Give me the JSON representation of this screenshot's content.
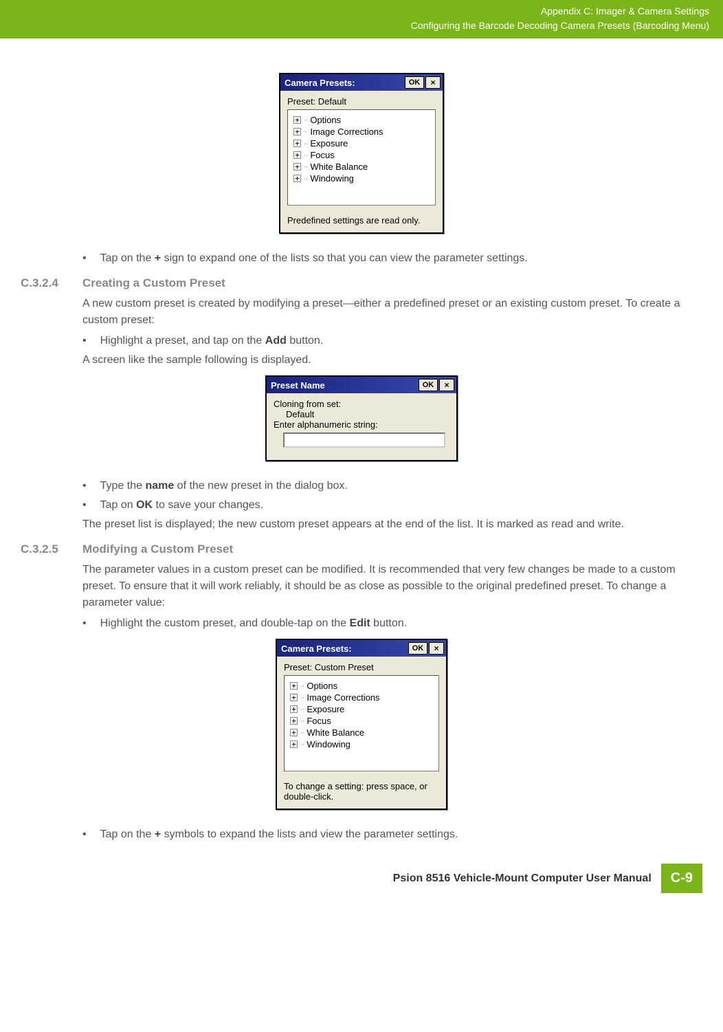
{
  "header": {
    "line1": "Appendix C: Imager & Camera Settings",
    "line2": "Configuring the Barcode Decoding Camera Presets (Barcoding Menu)"
  },
  "dialog1": {
    "title": "Camera Presets:",
    "ok": "OK",
    "close": "×",
    "preset_label": "Preset:  Default",
    "items": [
      "Options",
      "Image Corrections",
      "Exposure",
      "Focus",
      "White Balance",
      "Windowing"
    ],
    "status": "Predefined settings are read only."
  },
  "bullet1": "Tap on the + sign to expand one of the lists so that you can view the parameter settings.",
  "sec1": {
    "num": "C.3.2.4",
    "title": "Creating a Custom Preset"
  },
  "para1": "A new custom preset is created by modifying a preset—either a predefined preset or an existing custom preset. To create a custom preset:",
  "bullet2": "Highlight a preset, and tap on the Add button.",
  "para2": "A screen like the sample following is displayed.",
  "dialog2": {
    "title": "Preset Name",
    "ok": "OK",
    "close": "×",
    "line1": "Cloning from set:",
    "line2": "Default",
    "line3": "Enter alphanumeric string:"
  },
  "bullet3": "Type the name of the new preset in the dialog box.",
  "bullet4": "Tap on OK to save your changes.",
  "para3": "The preset list is displayed; the new custom preset appears at the end of the list. It is marked as read and write.",
  "sec2": {
    "num": "C.3.2.5",
    "title": "Modifying a Custom Preset"
  },
  "para4": "The parameter values in a custom preset can be modified. It is recommended that very few changes be made to a custom preset. To ensure that it will work reliably, it should be as close as possible to the original predefined preset. To change a parameter value:",
  "bullet5": "Highlight the custom preset, and double-tap on the Edit button.",
  "dialog3": {
    "title": "Camera Presets:",
    "ok": "OK",
    "close": "×",
    "preset_label": "Preset:  Custom Preset",
    "items": [
      "Options",
      "Image Corrections",
      "Exposure",
      "Focus",
      "White Balance",
      "Windowing"
    ],
    "status": "To change a setting: press space, or double-click."
  },
  "bullet6": "Tap on the + symbols to expand the lists and view the parameter settings.",
  "footer": {
    "text": "Psion 8516 Vehicle-Mount Computer User Manual",
    "page": "C-9"
  }
}
